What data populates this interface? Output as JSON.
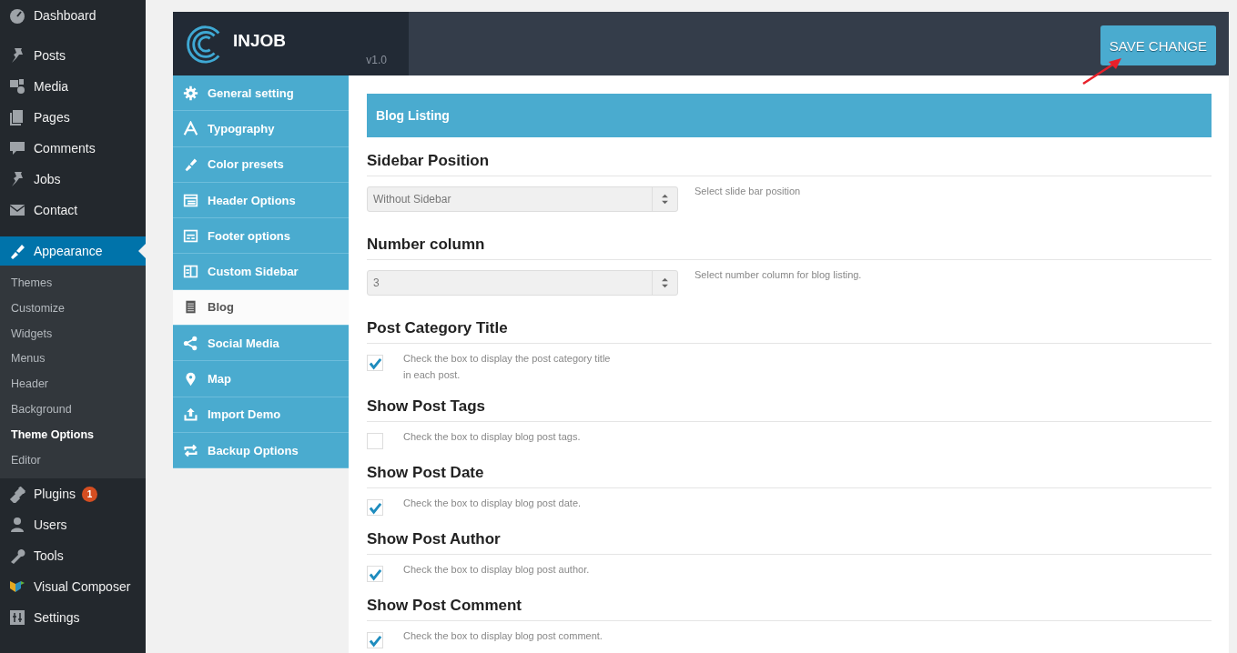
{
  "admin_menu": [
    {
      "label": "Dashboard",
      "selected": false
    },
    {
      "label": "Posts",
      "selected": false
    },
    {
      "label": "Media",
      "selected": false
    },
    {
      "label": "Pages",
      "selected": false
    },
    {
      "label": "Comments",
      "selected": false
    },
    {
      "label": "Jobs",
      "selected": false
    },
    {
      "label": "Contact",
      "selected": false
    },
    {
      "label": "Appearance",
      "selected": true,
      "submenu": [
        {
          "label": "Themes",
          "selected": false
        },
        {
          "label": "Customize",
          "selected": false
        },
        {
          "label": "Widgets",
          "selected": false
        },
        {
          "label": "Menus",
          "selected": false
        },
        {
          "label": "Header",
          "selected": false
        },
        {
          "label": "Background",
          "selected": false
        },
        {
          "label": "Theme Options",
          "selected": true
        },
        {
          "label": "Editor",
          "selected": false
        }
      ]
    },
    {
      "label": "Plugins",
      "selected": false,
      "badge": "1"
    },
    {
      "label": "Users",
      "selected": false
    },
    {
      "label": "Tools",
      "selected": false
    },
    {
      "label": "Visual Composer",
      "selected": false
    },
    {
      "label": "Settings",
      "selected": false
    }
  ],
  "panel": {
    "brand": "INJOB",
    "version": "v1.0",
    "save_button": "SAVE CHANGE",
    "nav": [
      {
        "label": "General setting",
        "selected": false
      },
      {
        "label": "Typography",
        "selected": false
      },
      {
        "label": "Color presets",
        "selected": false
      },
      {
        "label": "Header Options",
        "selected": false
      },
      {
        "label": "Footer options",
        "selected": false
      },
      {
        "label": "Custom Sidebar",
        "selected": false
      },
      {
        "label": "Blog",
        "selected": true
      },
      {
        "label": "Social Media",
        "selected": false
      },
      {
        "label": "Map",
        "selected": false
      },
      {
        "label": "Import Demo",
        "selected": false
      },
      {
        "label": "Backup Options",
        "selected": false
      }
    ],
    "section_title": "Blog Listing",
    "fields": [
      {
        "kind": "select",
        "title": "Sidebar Position",
        "value": "Without Sidebar",
        "help": "Select slide bar position"
      },
      {
        "kind": "select",
        "title": "Number column",
        "value": "3",
        "help": "Select number column for blog listing."
      },
      {
        "kind": "checkbox",
        "title": "Post Category Title",
        "checked": true,
        "help": "Check the box to display the post category title in each post."
      },
      {
        "kind": "checkbox",
        "title": "Show Post Tags",
        "checked": false,
        "help": "Check the box to display blog post tags."
      },
      {
        "kind": "checkbox",
        "title": "Show Post Date",
        "checked": true,
        "help": "Check the box to display blog post date."
      },
      {
        "kind": "checkbox",
        "title": "Show Post Author",
        "checked": true,
        "help": "Check the box to display blog post author."
      },
      {
        "kind": "checkbox",
        "title": "Show Post Comment",
        "checked": true,
        "help": "Check the box to display blog post comment."
      }
    ]
  }
}
